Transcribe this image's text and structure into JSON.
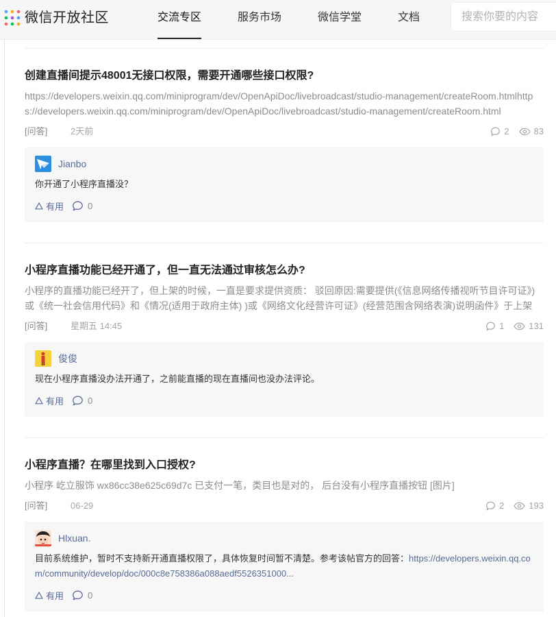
{
  "header": {
    "logo_text": "微信开放社区",
    "nav": [
      {
        "label": "交流专区",
        "active": true
      },
      {
        "label": "服务市场",
        "active": false
      },
      {
        "label": "微信学堂",
        "active": false
      },
      {
        "label": "文档",
        "active": false
      }
    ],
    "search_placeholder": "搜索你要的内容"
  },
  "posts": [
    {
      "title": "创建直播间提示48001无接口权限，需要开通哪些接口权限?",
      "summary": "https://developers.weixin.qq.com/miniprogram/dev/OpenApiDoc/livebroadcast/studio-management/createRoom.htmlhttps://developers.weixin.qq.com/miniprogram/dev/OpenApiDoc/livebroadcast/studio-management/createRoom.html",
      "tag": "[问答]",
      "time": "2天前",
      "comments": "2",
      "views": "83",
      "reply": {
        "author": "Jianbo",
        "avatar": "paper-plane-avatar",
        "text": "你开通了小程序直播没？",
        "link": "",
        "useful_label": "有用",
        "comment_count": "0"
      }
    },
    {
      "title": "小程序直播功能已经开通了，但一直无法通过审核怎么办?",
      "summary": "小程序的直播功能已经开了，但上架的时候，一直是要求提供资质： 驳回原因:需要提供(《信息网络传播视听节目许可证》)或《统一社会信用代码》和《情况(适用于政府主体) )或《网络文化经营许可证》(经营范围含网络表演)说明函件》于上架",
      "tag": "[问答]",
      "time": "星期五 14:45",
      "comments": "1",
      "views": "131",
      "reply": {
        "author": "俊俊",
        "avatar": "figure-avatar",
        "text": "现在小程序直播没办法开通了，之前能直播的现在直播间也没办法评论。",
        "link": "",
        "useful_label": "有用",
        "comment_count": "0"
      }
    },
    {
      "title": "小程序直播？在哪里找到入口授权?",
      "summary": "小程序 屹立服饰 wx86cc38e625c69d7c 已支付一笔，类目也是对的， 后台没有小程序直播按钮 [图片]",
      "tag": "[问答]",
      "time": "06-29",
      "comments": "2",
      "views": "193",
      "reply": {
        "author": "Hlxuan.",
        "avatar": "cartoon-avatar",
        "text": "目前系统维护，暂时不支持新开通直播权限了，具体恢复时间暂不清楚。参考该帖官方的回答：",
        "link": "https://developers.weixin.qq.com/community/develop/doc/000c8e758386a088aedf5526351000...",
        "useful_label": "有用",
        "comment_count": "0"
      }
    }
  ],
  "colors": {
    "link": "#576b95",
    "meta": "#a5a5a5",
    "reply_bg": "#f7f7f7"
  }
}
